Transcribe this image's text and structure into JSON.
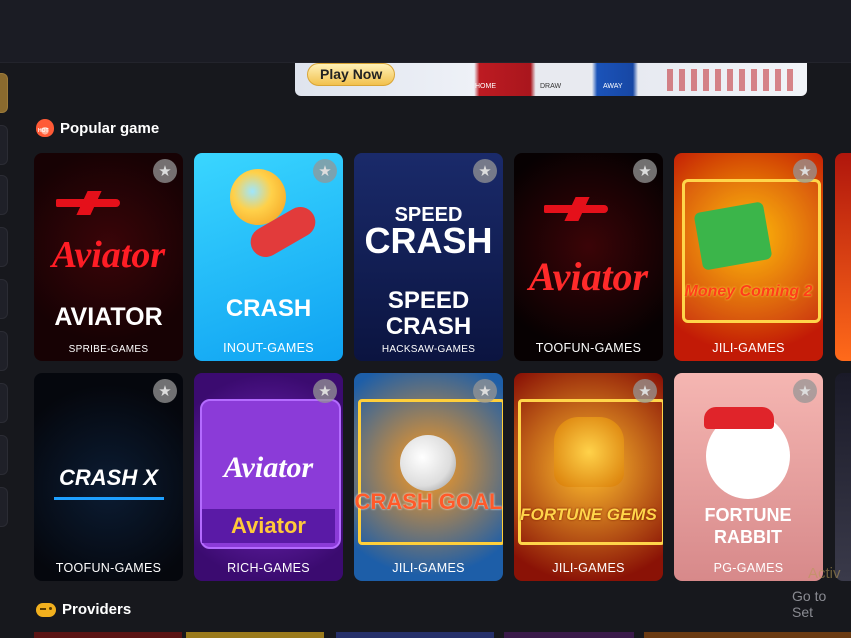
{
  "banner": {
    "cta_label": "Play Now",
    "team_home": "HOME",
    "team_draw": "DRAW",
    "team_away": "AWAY"
  },
  "popular": {
    "title": "Popular game",
    "hot_badge": "HOT",
    "games": [
      {
        "art": "AVIATOR",
        "provider": "SPRIBE-GAMES"
      },
      {
        "art": "CRASH",
        "provider": "INOUT-GAMES"
      },
      {
        "art": "SPEED CRASH",
        "provider": "HACKSAW-GAMES"
      },
      {
        "art": "Aviator",
        "provider": "TOOFUN-GAMES"
      },
      {
        "art": "Money Coming 2",
        "provider": "JILI-GAMES"
      },
      {
        "art": "CRASH X",
        "provider": "TOOFUN-GAMES"
      },
      {
        "art": "Aviator",
        "provider": "RICH-GAMES"
      },
      {
        "art": "CRASH GOAL",
        "provider": "JILI-GAMES"
      },
      {
        "art": "FORTUNE GEMS",
        "provider": "JILI-GAMES"
      },
      {
        "art": "FORTUNE RABBIT",
        "provider": "PG-GAMES"
      }
    ]
  },
  "providers": {
    "title": "Providers"
  },
  "os_watermark": {
    "line1": "Activ",
    "line2": "Go to Set"
  },
  "colors": {
    "background": "#17181d",
    "accent": "#8a6a2e"
  },
  "icons": {
    "favorite": "star-icon",
    "hot": "hot-flame-icon",
    "providers": "gamepad-icon"
  }
}
